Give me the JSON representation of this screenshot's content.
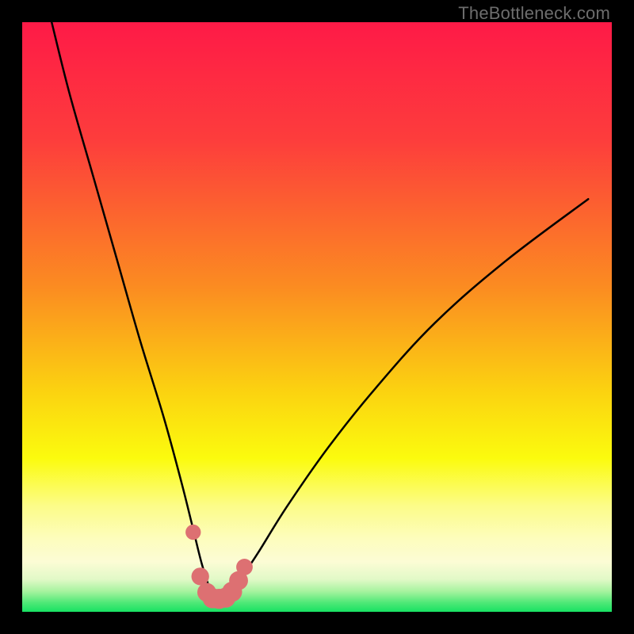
{
  "watermark": "TheBottleneck.com",
  "colors": {
    "frame": "#000000",
    "watermark": "#6d6d6d",
    "curve": "#000000",
    "marker_fill": "#dd7072",
    "gradient_stops": [
      {
        "offset": 0,
        "color": "#fe1a47"
      },
      {
        "offset": 0.2,
        "color": "#fd3d3c"
      },
      {
        "offset": 0.45,
        "color": "#fb8c21"
      },
      {
        "offset": 0.63,
        "color": "#fbd410"
      },
      {
        "offset": 0.74,
        "color": "#fbfb0e"
      },
      {
        "offset": 0.82,
        "color": "#fcfc88"
      },
      {
        "offset": 0.875,
        "color": "#fdfdbc"
      },
      {
        "offset": 0.915,
        "color": "#fcfcd5"
      },
      {
        "offset": 0.945,
        "color": "#e1f9c7"
      },
      {
        "offset": 0.965,
        "color": "#a7f39f"
      },
      {
        "offset": 0.985,
        "color": "#4de876"
      },
      {
        "offset": 1.0,
        "color": "#18e263"
      }
    ]
  },
  "chart_data": {
    "type": "line",
    "title": "",
    "xlabel": "",
    "ylabel": "",
    "x_range": [
      0,
      100
    ],
    "y_range": [
      0,
      100
    ],
    "note": "V-shaped bottleneck curve; y≈mismatch %, minimum near x≈33. Values estimated from pixel positions; no axis ticks are shown in the image.",
    "series": [
      {
        "name": "bottleneck-curve",
        "x": [
          5,
          8,
          12,
          16,
          20,
          24,
          27,
          29,
          30.5,
          32,
          33,
          34,
          35.5,
          37,
          40,
          45,
          52,
          60,
          70,
          82,
          96
        ],
        "y": [
          100,
          88,
          74,
          60,
          46,
          33,
          22,
          14,
          8,
          3.5,
          2.2,
          2.2,
          3.2,
          5.5,
          10,
          18,
          28,
          38,
          49,
          59.5,
          70
        ]
      }
    ],
    "markers": {
      "name": "highlight-points",
      "note": "Salmon dots/blobs near the curve minimum",
      "points": [
        {
          "x": 29.0,
          "y": 13.5,
          "r": 1.3
        },
        {
          "x": 30.2,
          "y": 6.0,
          "r": 1.5
        },
        {
          "x": 31.3,
          "y": 3.3,
          "r": 1.6
        },
        {
          "x": 32.3,
          "y": 2.3,
          "r": 1.7
        },
        {
          "x": 33.4,
          "y": 2.2,
          "r": 1.7
        },
        {
          "x": 34.5,
          "y": 2.4,
          "r": 1.7
        },
        {
          "x": 35.6,
          "y": 3.4,
          "r": 1.7
        },
        {
          "x": 36.7,
          "y": 5.3,
          "r": 1.6
        },
        {
          "x": 37.7,
          "y": 7.6,
          "r": 1.4
        }
      ]
    }
  }
}
